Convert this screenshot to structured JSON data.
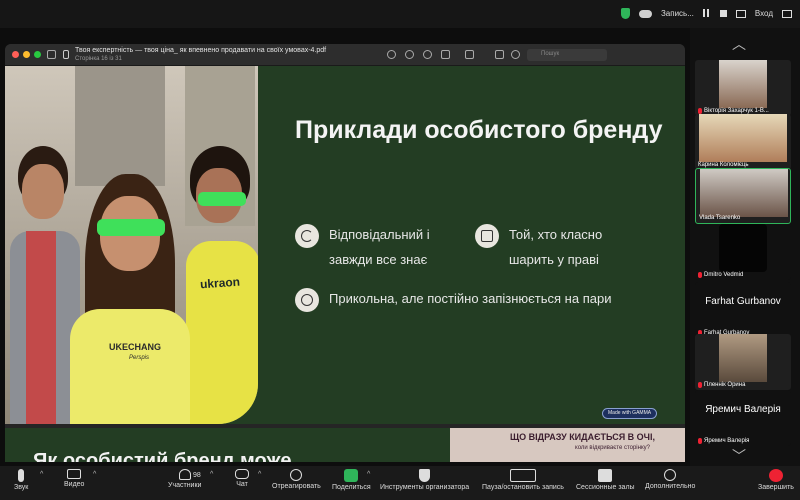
{
  "topbar": {
    "recording": "Запись...",
    "exit": "Вход"
  },
  "pdf": {
    "title": "Твоя експертність — твоя ціна_ як впевнено продавати на своїх умовах-4.pdf",
    "subtitle": "Сторінка 16 із 31",
    "search_placeholder": "Пошук"
  },
  "slide": {
    "title": "Приклади особистого бренду",
    "bullets": [
      {
        "text": "Відповідальний і завжди все знає",
        "icon": "clock-icon"
      },
      {
        "text": "Той, хто класно шарить у праві",
        "icon": "book-icon"
      },
      {
        "text": "Прикольна, але постійно запізнюється на пари",
        "icon": "gauge-icon"
      }
    ],
    "badge": "Made with GAMMA",
    "photo_shirt_1": "UKECHANG",
    "photo_shirt_1b": "Perspis",
    "photo_shirt_2": "ukraon"
  },
  "next_slide": {
    "title": "Як особистий бренд може",
    "question": "ЩО ВІДРАЗУ КИДАЄТЬСЯ В ОЧІ,",
    "question2": "коли відкриваєте сторінку?"
  },
  "participants": [
    {
      "name": "Вікторія Захарчук 1-В...",
      "muted": true
    },
    {
      "name": "Карина Коломієць",
      "muted": false
    },
    {
      "name": "Vlada Tsarenko",
      "muted": false,
      "active": true
    },
    {
      "name": "Dmitro Vedmid",
      "muted": true
    },
    {
      "name": "Farhat Gurbanov",
      "label": "Farhat Gurbanov",
      "muted": true
    },
    {
      "name": "Пленнік Орина",
      "muted": true
    },
    {
      "name": "Яремич Валерія",
      "label": "Яремич Валерія",
      "muted": true
    }
  ],
  "toolbar": {
    "audio": "Звук",
    "video": "Видео",
    "participants": "Участники",
    "participants_count": "98",
    "chat": "Чат",
    "react": "Отреагировать",
    "share": "Поделиться",
    "host_tools": "Инструменты организатора",
    "pause_rec": "Пауза/остановить запись",
    "breakout": "Сессионные залы",
    "more": "Дополнительно",
    "end": "Завершить"
  }
}
